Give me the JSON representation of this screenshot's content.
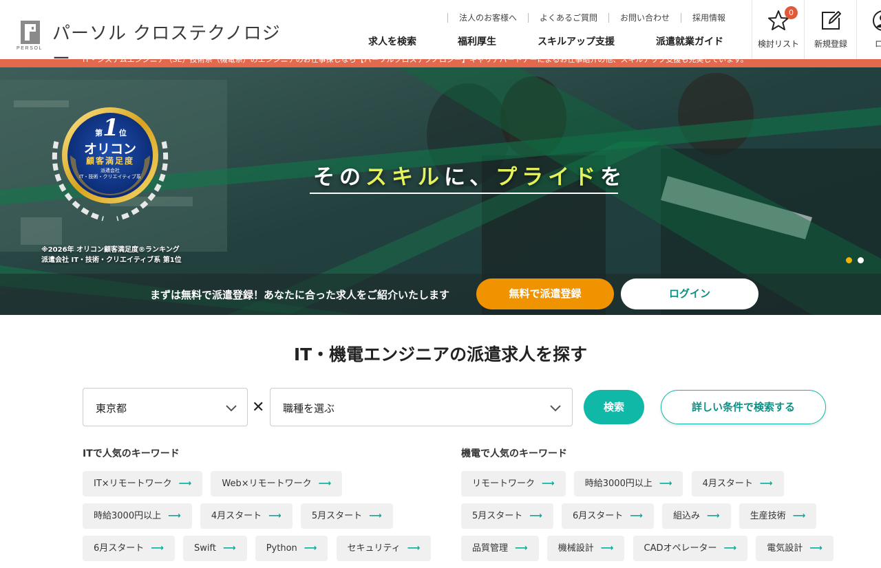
{
  "brand": {
    "logo_sub": "PERSOL",
    "name": "パーソル クロステクノロジー"
  },
  "utility_nav": [
    "法人のお客様へ",
    "よくあるご質問",
    "お問い合わせ",
    "採用情報"
  ],
  "main_nav": [
    "求人を検索",
    "福利厚生",
    "スキルアップ支援",
    "派遣就業ガイド"
  ],
  "header_buttons": {
    "favorites_label": "検討リスト",
    "favorites_count": "0",
    "register_label": "新規登録",
    "login_label": "ログ"
  },
  "hero": {
    "ticker": "IT・システムエンジニア（SE）技術系（機電系）のエンジニアのお仕事探しなら【パーソルクロステクノロジー】キャリアパートナーによるお仕事紹介の他、スキルアップ支援も充実しています。",
    "tagline_pre": "その",
    "tagline_skill": "スキル",
    "tagline_mid": "に、",
    "tagline_pride": "プライド",
    "tagline_post": "を",
    "badge_rank_prefix": "第",
    "badge_rank_number": "1",
    "badge_rank_suffix": "位",
    "badge_brand": "オリコン",
    "badge_title": "顧客満足度",
    "badge_category1": "派遣会社",
    "badge_category2": "IT・技術・クリエイティブ系",
    "ranking_note_line1": "※2026年 オリコン顧客満足度®ランキング",
    "ranking_note_line2": "派遣会社 IT・技術・クリエイティブ系 第1位",
    "cta_text": "まずは無料で派遣登録！あなたに合った求人をご紹介いたします",
    "cta_register": "無料で派遣登録",
    "cta_login": "ログイン"
  },
  "search": {
    "title": "IT・機電エンジニアの派遣求人を探す",
    "location_value": "東京都",
    "job_type_placeholder": "職種を選ぶ",
    "cross": "✕",
    "search_button": "検索",
    "detail_button": "詳しい条件で検索する"
  },
  "keywords": {
    "it_title": "ITで人気のキーワード",
    "it_items": [
      "IT×リモートワーク",
      "Web×リモートワーク",
      "時給3000円以上",
      "4月スタート",
      "5月スタート",
      "6月スタート",
      "Swift",
      "Python",
      "セキュリティ"
    ],
    "mech_title": "機電で人気のキーワード",
    "mech_items": [
      "リモートワーク",
      "時給3000円以上",
      "4月スタート",
      "5月スタート",
      "6月スタート",
      "組込み",
      "生産技術",
      "品質管理",
      "機械設計",
      "CADオペレーター",
      "電気設計"
    ],
    "arrow": "⟶"
  },
  "colors": {
    "accent_teal": "#10b8a8",
    "cta_orange": "#f09300",
    "ticker_red": "#e2694e",
    "tagline_highlight": "#e4f25c"
  }
}
